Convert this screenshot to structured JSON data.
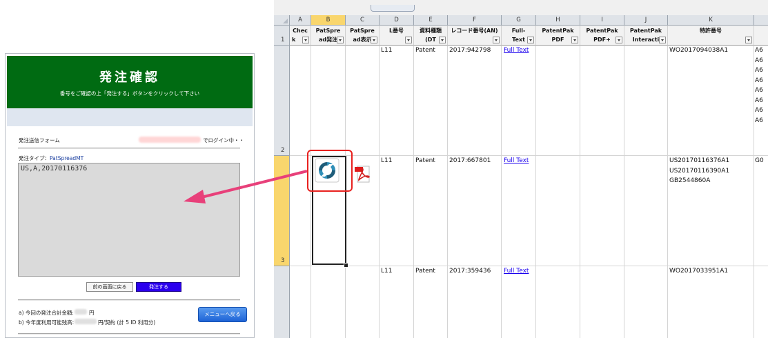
{
  "form": {
    "title": "発注確認",
    "subtitle": "番号をご確認の上「発注する」ボタンをクリックして下さい",
    "section_label": "発注送信フォーム",
    "login_suffix": "でログイン中・・",
    "order_type_label": "発注タイプ：",
    "order_type_value": "PatSpreadMT",
    "textarea_value": "US,A,20170116376",
    "back_button": "前の画面に戻る",
    "order_button": "発注する",
    "total_label": "a) 今回の発注合計金額:",
    "total_unit": "円",
    "balance_label": "b) 今年度利用可能残高:",
    "balance_suffix": "円/契約 (計 5 ID 利用分)",
    "menu_button": "メニューへ戻る"
  },
  "sheet": {
    "columns": [
      {
        "letter": "A",
        "header1": "Chec",
        "header2": "k"
      },
      {
        "letter": "B",
        "header1": "PatSpre",
        "header2": "ad発注"
      },
      {
        "letter": "C",
        "header1": "PatSpre",
        "header2": "ad表示"
      },
      {
        "letter": "D",
        "header1": "L番号",
        "header2": ""
      },
      {
        "letter": "E",
        "header1": "資料種類",
        "header2": "(DT"
      },
      {
        "letter": "F",
        "header1": "レコード番号(AN)",
        "header2": ""
      },
      {
        "letter": "G",
        "header1": "Full-",
        "header2": "Text"
      },
      {
        "letter": "H",
        "header1": "PatentPak",
        "header2": "PDF"
      },
      {
        "letter": "I",
        "header1": "PatentPak",
        "header2": "PDF+"
      },
      {
        "letter": "J",
        "header1": "PatentPak",
        "header2": "Interacti"
      },
      {
        "letter": "K",
        "header1": "特許番号",
        "header2": ""
      }
    ],
    "row_numbers": [
      "1",
      "2",
      "3"
    ],
    "rows": [
      {
        "l_number": "L11",
        "doc_type": "Patent",
        "record": "2017:942798",
        "fulltext": "Full Text",
        "patents": [
          "WO2017094038A1"
        ],
        "next_col": [
          "A6",
          "A6",
          "A6",
          "A6",
          "A6",
          "A6",
          "A6",
          "A6"
        ]
      },
      {
        "l_number": "L11",
        "doc_type": "Patent",
        "record": "2017:667801",
        "fulltext": "Full Text",
        "patents": [
          "US20170116376A1",
          "US20170116390A1",
          "GB2544860A"
        ],
        "next_col": [
          "G0"
        ]
      },
      {
        "l_number": "L11",
        "doc_type": "Patent",
        "record": "2017:359436",
        "fulltext": "Full Text",
        "patents": [
          "WO2017033951A1"
        ],
        "next_col": []
      }
    ]
  },
  "colors": {
    "header_green": "#006b12",
    "order_button": "#2b00ee",
    "menu_button": "#1d63d6",
    "arrow": "#e8407a",
    "highlight": "#e8201e",
    "selected_header": "#f9d66d"
  },
  "icons": [
    "patspread-icon",
    "pdf-icon",
    "dropdown-arrow-icon",
    "arrow-pointer"
  ]
}
